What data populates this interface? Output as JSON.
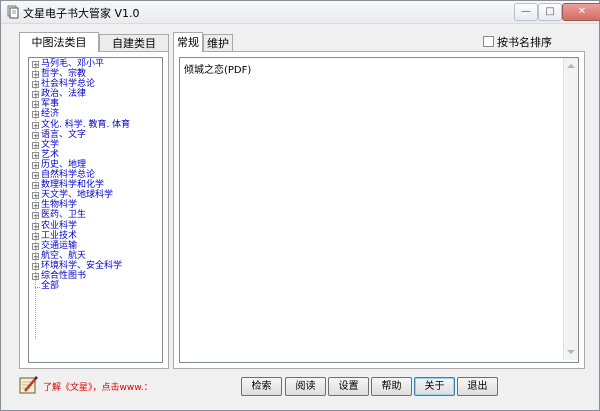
{
  "window": {
    "title": "文星电子书大管家 V1.0",
    "controls": {
      "minimize": "—",
      "maximize": "□",
      "close": "✕"
    }
  },
  "left_tabs": [
    {
      "label": "中图法类目",
      "active": true
    },
    {
      "label": "自建类目",
      "active": false
    }
  ],
  "tree": {
    "items": [
      {
        "label": "马列毛、邓小平",
        "expand": "+"
      },
      {
        "label": "哲学、宗教",
        "expand": "+"
      },
      {
        "label": "社会科学总论",
        "expand": "+"
      },
      {
        "label": "政治、法律",
        "expand": "+"
      },
      {
        "label": "军事",
        "expand": "+"
      },
      {
        "label": "经济",
        "expand": "+"
      },
      {
        "label": "文化. 科学. 教育. 体育",
        "expand": "+"
      },
      {
        "label": "语言、文字",
        "expand": "+"
      },
      {
        "label": "文学",
        "expand": "+"
      },
      {
        "label": "艺术",
        "expand": "+"
      },
      {
        "label": "历史、地理",
        "expand": "+"
      },
      {
        "label": "自然科学总论",
        "expand": "+"
      },
      {
        "label": "数理科学和化学",
        "expand": "+"
      },
      {
        "label": "天文学、地球科学",
        "expand": "+"
      },
      {
        "label": "生物科学",
        "expand": "+"
      },
      {
        "label": "医药、卫生",
        "expand": "+"
      },
      {
        "label": "农业科学",
        "expand": "+"
      },
      {
        "label": "工业技术",
        "expand": "+"
      },
      {
        "label": "交通运输",
        "expand": "+"
      },
      {
        "label": "航空、航天",
        "expand": "+"
      },
      {
        "label": "环境科学、安全科学",
        "expand": "+"
      },
      {
        "label": "综合性图书",
        "expand": "+"
      },
      {
        "label": "全部",
        "expand": ""
      }
    ]
  },
  "right_tabs": [
    {
      "label": "常规",
      "active": true
    },
    {
      "label": "维护",
      "active": false
    }
  ],
  "sort_option": {
    "label": "按书名排序",
    "checked": false
  },
  "content": {
    "text": "倾城之恋(PDF)"
  },
  "promo": {
    "text": "了解《文星》，点击www.："
  },
  "buttons": {
    "search": "检索",
    "read": "阅读",
    "settings": "设置",
    "help": "帮助",
    "about": "关于",
    "exit": "退出"
  },
  "colors": {
    "tree_label": "#0000cc",
    "promo_text": "#e00000",
    "close_button": "#d36b63"
  }
}
